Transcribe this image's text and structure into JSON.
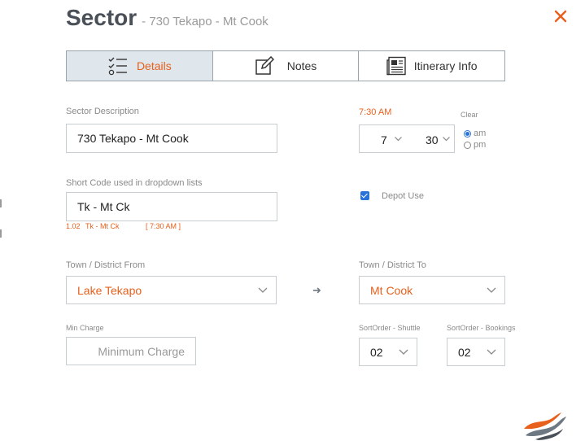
{
  "header": {
    "title": "Sector",
    "subtitle": "- 730 Tekapo - Mt Cook"
  },
  "tabs": [
    {
      "label": "Details",
      "icon": "checklist-icon",
      "active": true
    },
    {
      "label": "Notes",
      "icon": "edit-note-icon",
      "active": false
    },
    {
      "label": "Itinerary Info",
      "icon": "newspaper-icon",
      "active": false
    }
  ],
  "sector_description": {
    "label": "Sector Description",
    "value": "730 Tekapo - Mt Cook"
  },
  "time": {
    "display": "7:30 AM",
    "clear_label": "Clear",
    "hour": "7",
    "minute": "30",
    "am_label": "am",
    "pm_label": "pm",
    "period": "am"
  },
  "short_code": {
    "label": "Short Code used in dropdown lists",
    "value": "Tk - Mt Ck",
    "preview_number": "1.02",
    "preview_code": "Tk - Mt Ck",
    "preview_time": "[ 7:30 AM ]"
  },
  "depot_use": {
    "label": "Depot Use",
    "checked": true
  },
  "town_from": {
    "label": "Town / District From",
    "value": "Lake Tekapo"
  },
  "town_to": {
    "label": "Town / District To",
    "value": "Mt Cook"
  },
  "min_charge": {
    "label": "Min Charge",
    "placeholder": "Minimum Charge"
  },
  "sort_shuttle": {
    "label": "SortOrder - Shuttle",
    "value": "02"
  },
  "sort_bookings": {
    "label": "SortOrder - Bookings",
    "value": "02"
  },
  "colors": {
    "accent": "#e8601c",
    "tab_active_bg": "#dfe6ec",
    "border": "#c8cdd1",
    "title": "#4a5058",
    "radio": "#2a72d8"
  }
}
